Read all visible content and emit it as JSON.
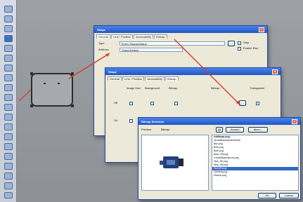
{
  "dialog_general": {
    "title": "Shape",
    "tabs": [
      "General",
      "Line / Position",
      "Accessibility",
      "Bitmap"
    ],
    "type_label": "Type",
    "type_value": "Every ShapeDefault",
    "address_label": "Address",
    "address_value": "ShapeDefault",
    "step_label": "Step",
    "enable_label": "Enable Else"
  },
  "dialog_bitmap": {
    "title": "Shape",
    "tabs": [
      "General",
      "Line / Position",
      "Accessibility",
      "Bitmap"
    ],
    "columns": [
      "Image Size",
      "Background",
      "Bitmap",
      "Bitmap",
      "Transparent"
    ],
    "rows": [
      "Off",
      "On"
    ]
  },
  "dialog_selection": {
    "title": "Bitmap Selection",
    "preview_label": "Preview",
    "bitmap_label": "Bitmap",
    "search_label": "Search",
    "more_label": "More...",
    "list_header": "ssbitmap.png",
    "files": [
      "ArrowBackward4Default",
      "Bkn.png",
      "Bulb.png",
      "Bulb.png",
      "Bulb_Off.png",
      "ComboBlackArrow.png",
      "Disk_Dir.png",
      "Disk_Off.png",
      "DiskOff.png",
      "General.png",
      "Search.png"
    ],
    "selected_index": 8,
    "ok_label": "OK",
    "cancel_label": "Cancel"
  }
}
